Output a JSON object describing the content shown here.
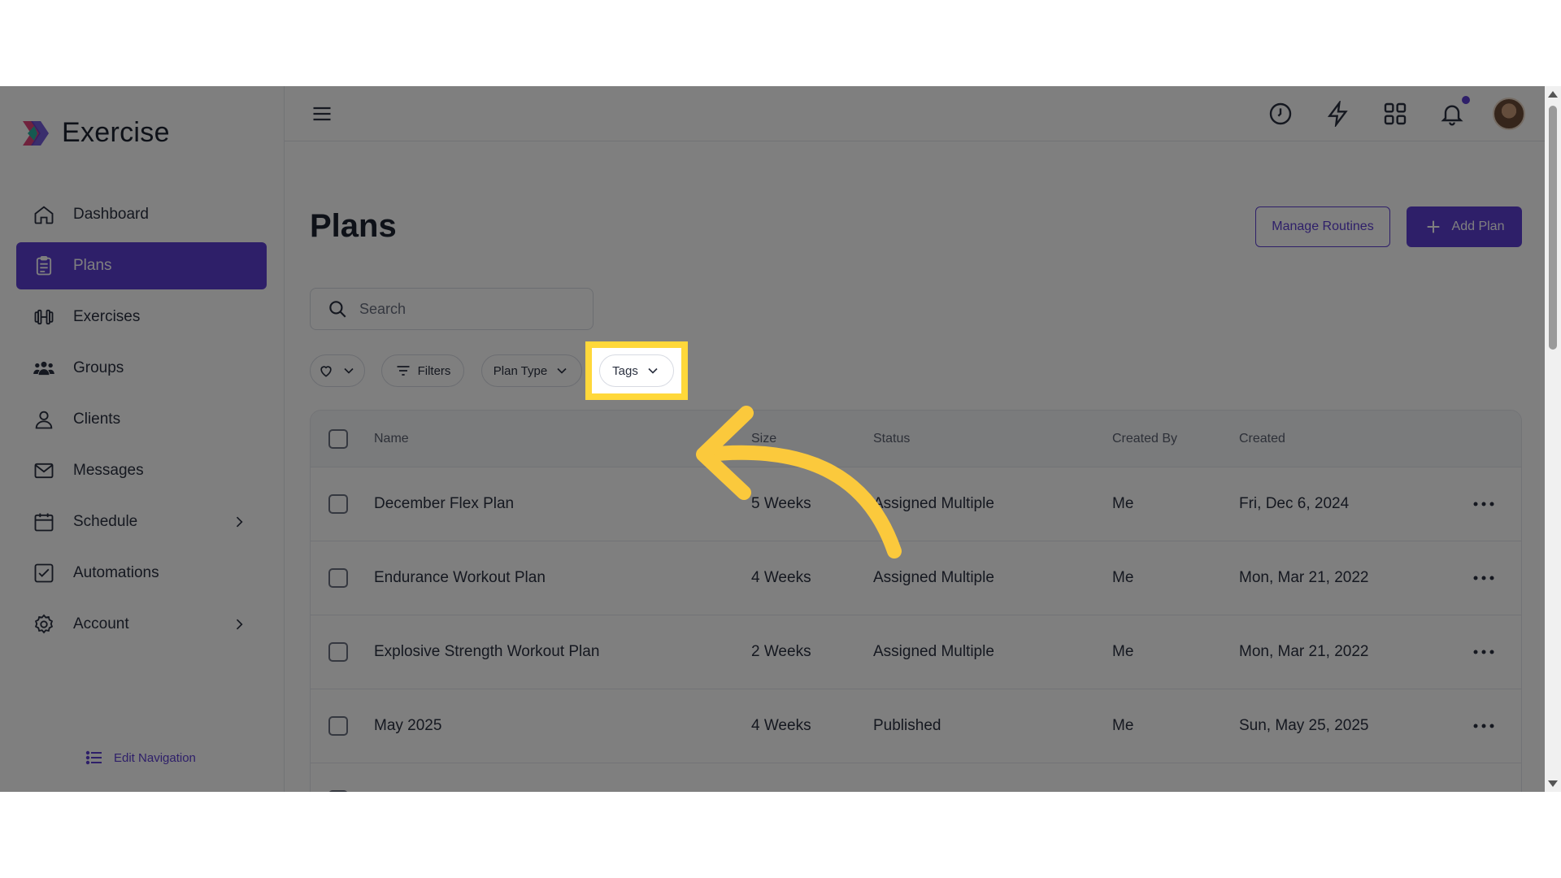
{
  "app": {
    "name": "Exercise"
  },
  "sidebar": {
    "items": [
      {
        "label": "Dashboard",
        "icon": "home-icon"
      },
      {
        "label": "Plans",
        "icon": "clipboard-icon",
        "active": true
      },
      {
        "label": "Exercises",
        "icon": "dumbbell-icon"
      },
      {
        "label": "Groups",
        "icon": "group-icon"
      },
      {
        "label": "Clients",
        "icon": "user-icon"
      },
      {
        "label": "Messages",
        "icon": "mail-icon"
      },
      {
        "label": "Schedule",
        "icon": "calendar-icon",
        "has_submenu": true
      },
      {
        "label": "Automations",
        "icon": "checkbox-icon"
      },
      {
        "label": "Account",
        "icon": "gear-icon",
        "has_submenu": true
      }
    ],
    "edit_navigation": "Edit Navigation"
  },
  "topbar": {
    "icons": [
      "clock-icon",
      "lightning-icon",
      "grid-icon",
      "bell-icon"
    ]
  },
  "page": {
    "title": "Plans",
    "manage_routines": "Manage Routines",
    "add_plan": "Add Plan"
  },
  "search": {
    "placeholder": "Search"
  },
  "filters": {
    "filters_label": "Filters",
    "plan_type_label": "Plan Type",
    "tags_label": "Tags"
  },
  "table": {
    "columns": {
      "name": "Name",
      "size": "Size",
      "status": "Status",
      "created_by": "Created By",
      "created": "Created"
    },
    "rows": [
      {
        "name": "December Flex Plan",
        "size": "5 Weeks",
        "status": "Assigned Multiple",
        "created_by": "Me",
        "created": "Fri, Dec 6, 2024"
      },
      {
        "name": "Endurance Workout Plan",
        "size": "4 Weeks",
        "status": "Assigned Multiple",
        "created_by": "Me",
        "created": "Mon, Mar 21, 2022"
      },
      {
        "name": "Explosive Strength Workout Plan",
        "size": "2 Weeks",
        "status": "Assigned Multiple",
        "created_by": "Me",
        "created": "Mon, Mar 21, 2022"
      },
      {
        "name": "May 2025",
        "size": "4 Weeks",
        "status": "Published",
        "created_by": "Me",
        "created": "Sun, May 25, 2025"
      }
    ]
  },
  "colors": {
    "accent": "#5d3fd3",
    "highlight": "#ffd83a",
    "arrow": "#fbc93c"
  }
}
